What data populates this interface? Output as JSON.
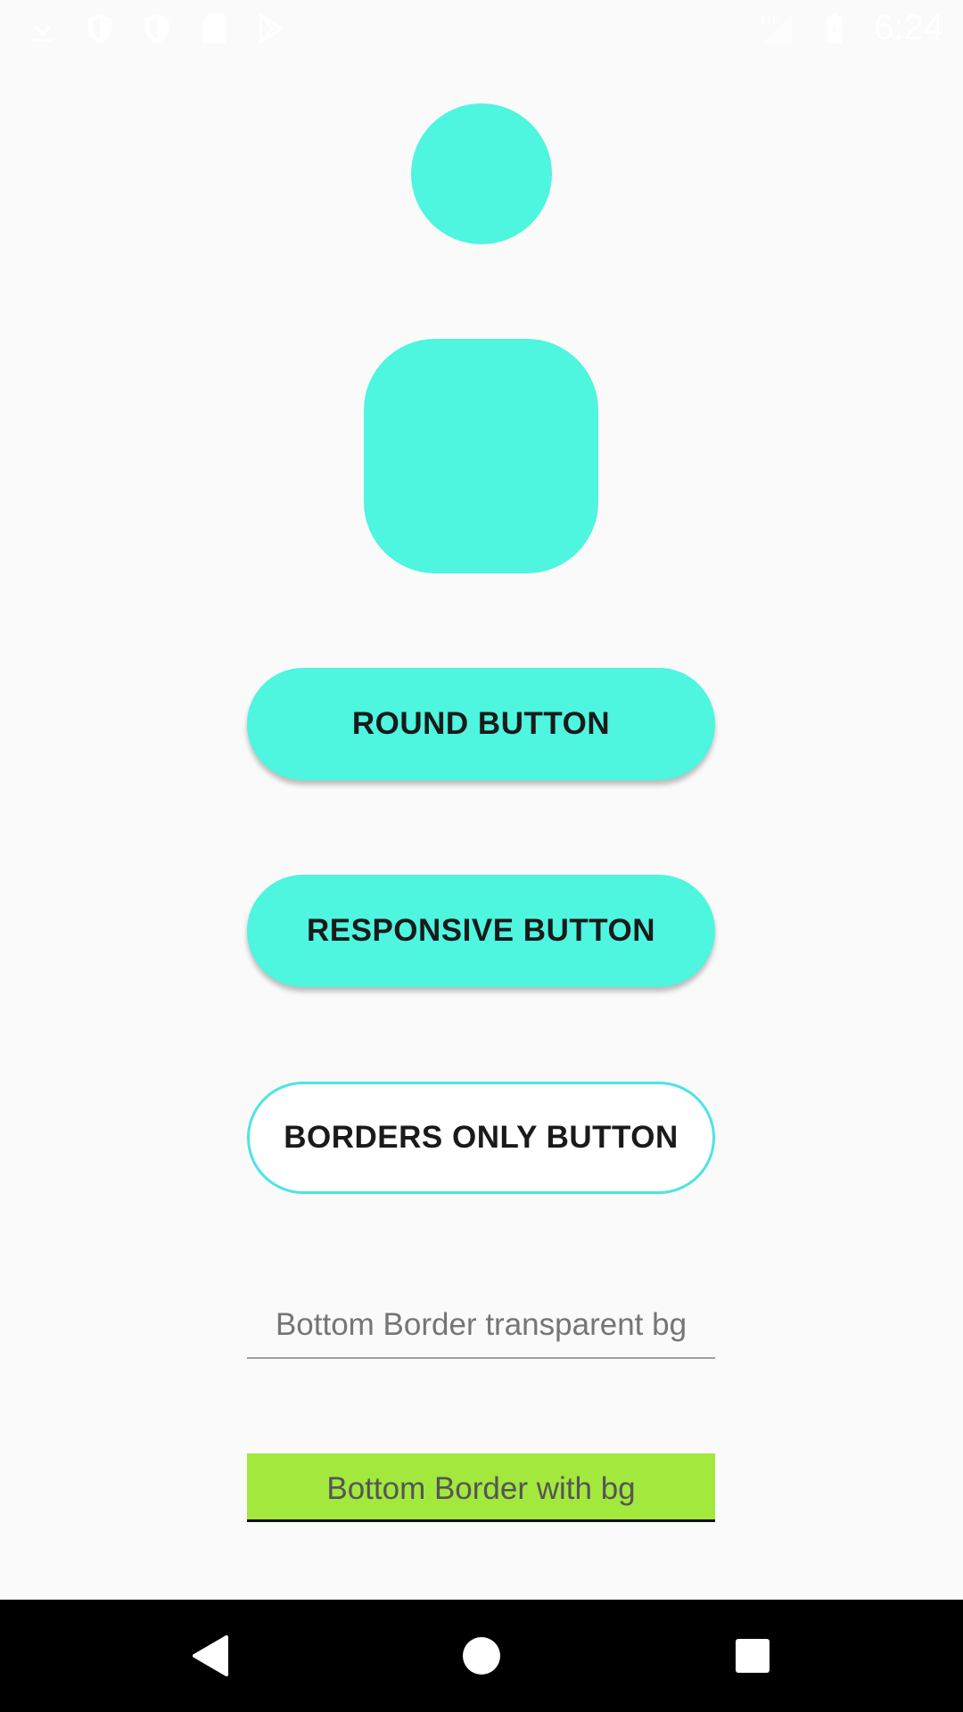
{
  "status_bar": {
    "time": "6:24",
    "left_icons": [
      "download-icon",
      "shield-icon",
      "shield-icon",
      "sd-card-icon",
      "play-store-icon"
    ],
    "right_icons": [
      "lte-signal-icon",
      "battery-icon"
    ]
  },
  "colors": {
    "accent": "#4ef5df",
    "input_bg": "#a2e83d",
    "border_button": "#4ee4e4",
    "page_bg": "#fafafa",
    "nav_bg": "#000000"
  },
  "buttons": {
    "round": "ROUND BUTTON",
    "responsive": "RESPONSIVE BUTTON",
    "borders_only": "BORDERS ONLY BUTTON"
  },
  "inputs": {
    "transparent_placeholder": "Bottom Border transparent bg",
    "with_bg_placeholder": "Bottom Border with bg"
  },
  "nav": {
    "icons": [
      "back-icon",
      "home-icon",
      "recent-apps-icon"
    ]
  }
}
